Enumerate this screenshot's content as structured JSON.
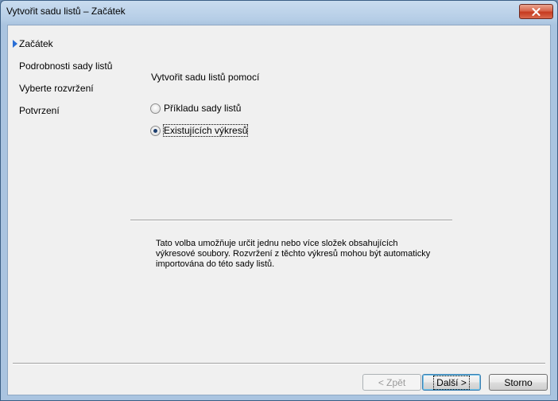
{
  "window": {
    "title": "Vytvořit sadu listů – Začátek"
  },
  "nav": {
    "items": [
      {
        "label": "Začátek",
        "active": true
      },
      {
        "label": "Podrobnosti sady listů",
        "active": false
      },
      {
        "label": "Vyberte rozvržení",
        "active": false
      },
      {
        "label": "Potvrzení",
        "active": false
      }
    ]
  },
  "main": {
    "section_label": "Vytvořit sadu listů pomocí",
    "options": [
      {
        "label": "Příkladu sady listů",
        "checked": false
      },
      {
        "label": "Existujících výkresů",
        "checked": true
      }
    ],
    "description": "Tato volba umožňuje určit jednu nebo více složek obsahujících výkresové soubory. Rozvržení z těchto výkresů mohou být automaticky importována do této sady listů."
  },
  "buttons": {
    "back_label": "< Zpět",
    "next_label": "Další >",
    "cancel_label": "Storno"
  },
  "colors": {
    "accent": "#2a6fd6",
    "close_button": "#c63a1f"
  }
}
